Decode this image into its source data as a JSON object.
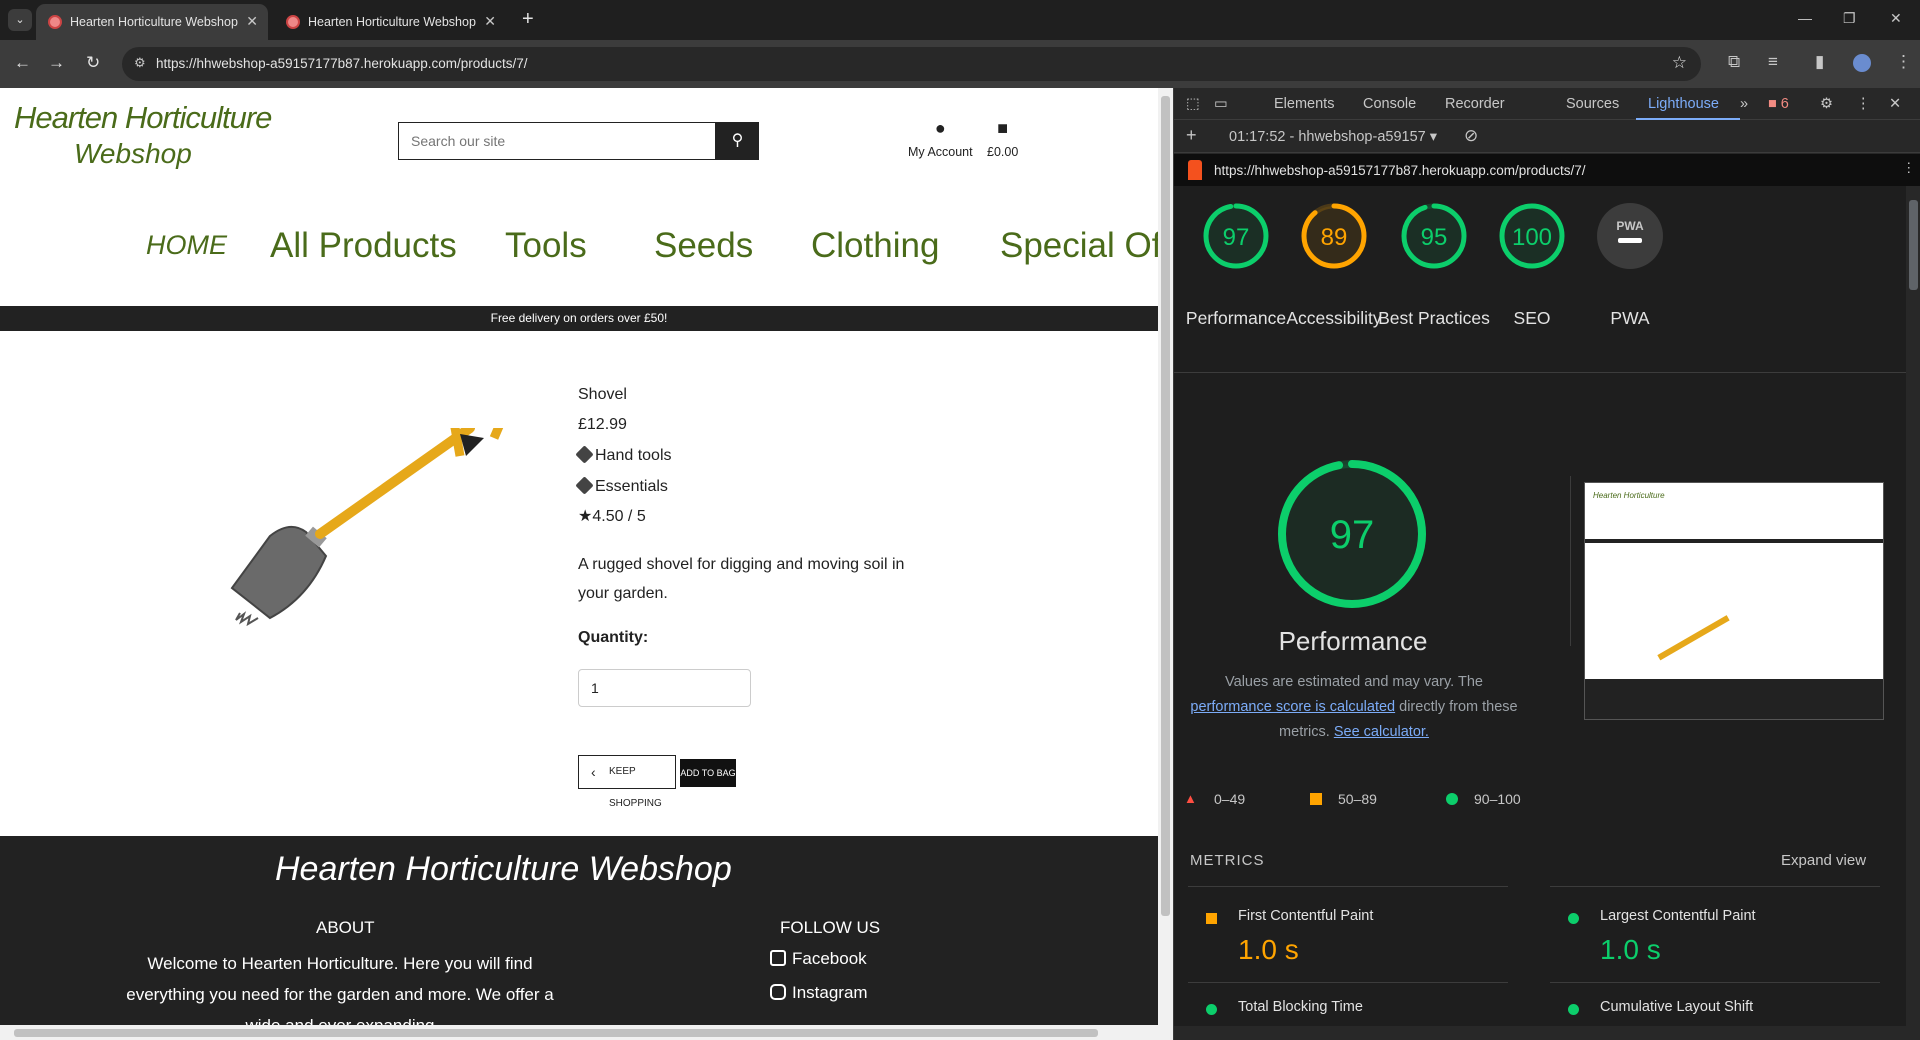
{
  "browser": {
    "tabs": [
      {
        "title": "Hearten Horticulture Webshop",
        "active": true
      },
      {
        "title": "Hearten Horticulture Webshop",
        "active": false
      }
    ],
    "url": "https://hhwebshop-a59157177b87.herokuapp.com/products/7/"
  },
  "site": {
    "logo_line1": "Hearten Horticulture",
    "logo_line2": "Webshop",
    "search_placeholder": "Search our site",
    "my_account": "My Account",
    "bag_total": "£0.00",
    "menu": [
      "HOME",
      "All Products",
      "Tools",
      "Seeds",
      "Clothing",
      "Special Offe"
    ],
    "delivery_banner": "Free delivery on orders over £50!",
    "product": {
      "name": "Shovel",
      "price": "£12.99",
      "categories": [
        "Hand tools",
        "Essentials"
      ],
      "rating": "4.50 / 5",
      "description": "A rugged shovel for digging and moving soil in your garden.",
      "quantity_label": "Quantity:",
      "quantity_value": "1",
      "keep_shopping": "KEEP SHOPPING",
      "add_to_bag": "ADD TO BAG"
    },
    "footer": {
      "title_bold": "Hearten Horticulture",
      "title_light": "Webshop",
      "about_heading": "ABOUT",
      "about_text": "Welcome to Hearten Horticulture. Here you will find everything you need for the garden and more. We offer a wide and ever expanding",
      "follow_heading": "FOLLOW US",
      "social": [
        "Facebook",
        "Instagram"
      ]
    }
  },
  "devtools": {
    "tabs": [
      "Elements",
      "Console",
      "Recorder",
      "Sources",
      "Lighthouse"
    ],
    "issues_count": "6",
    "report_label": "01:17:52 - hhwebshop-a59157",
    "report_url": "https://hhwebshop-a59157177b87.herokuapp.com/products/7/",
    "scores": [
      {
        "label": "Performance",
        "value": 97,
        "color": "#0cce6b"
      },
      {
        "label": "Accessibility",
        "value": 89,
        "color": "#ffa400"
      },
      {
        "label": "Best Practices",
        "value": 95,
        "color": "#0cce6b"
      },
      {
        "label": "SEO",
        "value": 100,
        "color": "#0cce6b"
      },
      {
        "label": "PWA",
        "value": "PWA",
        "color": "#5f6368"
      }
    ],
    "big_score": {
      "label": "Performance",
      "value": 97
    },
    "estimate_text_1": "Values are estimated and may vary. The",
    "estimate_link": "performance score is calculated",
    "estimate_text_2": "directly from these",
    "estimate_text_3": "metrics.",
    "calculator_link": "See calculator.",
    "legend": [
      "0–49",
      "50–89",
      "90–100"
    ],
    "metrics_heading": "METRICS",
    "expand_view": "Expand view",
    "metrics": [
      {
        "name": "First Contentful Paint",
        "value": "1.0 s",
        "color": "#ffa400"
      },
      {
        "name": "Largest Contentful Paint",
        "value": "1.0 s",
        "color": "#0cce6b"
      },
      {
        "name": "Total Blocking Time",
        "value": "",
        "color": "#0cce6b"
      },
      {
        "name": "Cumulative Layout Shift",
        "value": "",
        "color": "#0cce6b"
      }
    ]
  }
}
